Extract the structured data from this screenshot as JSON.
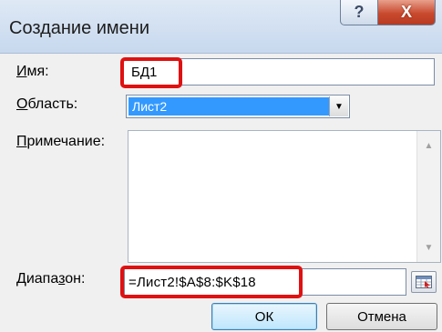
{
  "dialog": {
    "title": "Создание имени",
    "help_label": "?",
    "close_label": "X"
  },
  "form": {
    "name_label_hotkey": "И",
    "name_label_rest": "мя:",
    "name_value": "БД1",
    "scope_label_hotkey": "О",
    "scope_label_rest": "бласть:",
    "scope_value": "Лист2",
    "comment_label_hotkey": "П",
    "comment_label_rest": "римечание:",
    "comment_value": "",
    "range_label_pre": "Диапа",
    "range_label_hotkey": "з",
    "range_label_post": "он:",
    "range_value": "=Лист2!$A$8:$K$18"
  },
  "buttons": {
    "ok": "ОК",
    "cancel": "Отмена"
  },
  "colors": {
    "highlight_red": "#e01111",
    "selection_blue": "#3399ff",
    "close_red": "#c94a2e"
  }
}
